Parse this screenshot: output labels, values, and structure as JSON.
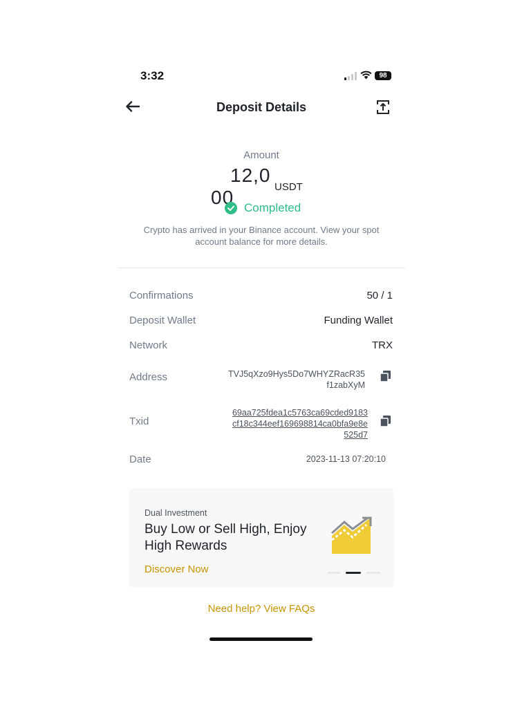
{
  "status_bar": {
    "time": "3:32",
    "battery": "98"
  },
  "header": {
    "title": "Deposit Details"
  },
  "amount": {
    "label": "Amount",
    "value_line1": "12,0",
    "value_line2": "00",
    "unit": "USDT",
    "status": "Completed",
    "note": "Crypto has arrived in your Binance account. View your spot account balance for more details."
  },
  "details": {
    "confirmations": {
      "label": "Confirmations",
      "value": "50 / 1"
    },
    "deposit_wallet": {
      "label": "Deposit Wallet",
      "value": "Funding Wallet"
    },
    "network": {
      "label": "Network",
      "value": "TRX"
    },
    "address": {
      "label": "Address",
      "value": "TVJ5qXzo9Hys5Do7WHYZRacR35f1zabXyM"
    },
    "txid": {
      "label": "Txid",
      "value": "69aa725fdea1c5763ca69cded9183cf18c344eef169698814ca0bfa9e8e525d7"
    },
    "date": {
      "label": "Date",
      "value": "2023-11-13 07:20:10"
    }
  },
  "promo": {
    "category": "Dual Investment",
    "title": "Buy Low or Sell High, Enjoy High Rewards",
    "cta": "Discover Now"
  },
  "footer": {
    "help_link": "Need help? View FAQs"
  },
  "colors": {
    "accent": "#c99400",
    "success": "#2ebd85",
    "muted": "#707a8a",
    "text": "#1e2329"
  }
}
